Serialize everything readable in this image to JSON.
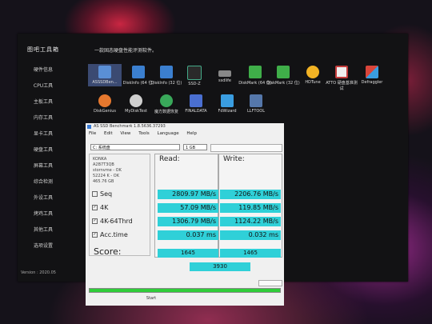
{
  "sidebar": {
    "title": "图吧工具箱",
    "items": [
      "硬件信息",
      "CPU工具",
      "主板工具",
      "内存工具",
      "显卡工具",
      "硬盘工具",
      "屏幕工具",
      "综合检测",
      "外设工具",
      "烤鸡工具",
      "其他工具",
      "选项设置"
    ],
    "version": "Version : 2020.05"
  },
  "main": {
    "description": "一款固态硬盘性能评测软件。",
    "apps_row1": [
      {
        "label": "ASSSDBen...",
        "icon": "as-ssd-icon",
        "color": "#5a8fd6",
        "selected": true
      },
      {
        "label": "DiskInfo (64 位)",
        "icon": "diskinfo-icon",
        "color": "#3b7fcf"
      },
      {
        "label": "DiskInfo (32 位)",
        "icon": "diskinfo-icon",
        "color": "#3b7fcf"
      },
      {
        "label": "SSD-Z",
        "icon": "ssdz-icon",
        "color": "#2a2a2a"
      },
      {
        "label": "ssdlife",
        "icon": "ssdlife-icon",
        "color": "#888888"
      },
      {
        "label": "DiskMark (64 位)",
        "icon": "diskmark-icon",
        "color": "#3fae49"
      },
      {
        "label": "DiskMark (32 位)",
        "icon": "diskmark-icon",
        "color": "#3fae49"
      },
      {
        "label": "HDTune",
        "icon": "hdtune-icon",
        "color": "#f2b324"
      },
      {
        "label": "ATTO 硬盘基准测试",
        "icon": "atto-icon",
        "color": "#c23b3b"
      },
      {
        "label": "Defraggler",
        "icon": "defraggler-icon",
        "color": "#d9453b"
      }
    ],
    "apps_row2": [
      {
        "label": "DiskGenius",
        "icon": "diskgenius-icon",
        "color": "#e6782e"
      },
      {
        "label": "MyDiskTest",
        "icon": "mydisktest-icon",
        "color": "#cfcfcf"
      },
      {
        "label": "魔方数据恢复",
        "icon": "recovery-icon",
        "color": "#39a85a"
      },
      {
        "label": "FINALDATA",
        "icon": "finaldata-icon",
        "color": "#4a6fd1"
      },
      {
        "label": "FdWizard",
        "icon": "fdwizard-icon",
        "color": "#3a9de0"
      },
      {
        "label": "LLFTOOL",
        "icon": "llftool-icon",
        "color": "#5577aa"
      }
    ]
  },
  "asssd": {
    "title": "AS SSD Benchmark 1.8.5636.37293",
    "menu": [
      "File",
      "Edit",
      "View",
      "Tools",
      "Language",
      "Help"
    ],
    "drive": "C: 系统盘",
    "size": "1 GB",
    "info_lines": [
      "KONKA",
      "A2B7T3QB",
      "stornvme - OK",
      "52224 K - OK",
      "465.76 GB"
    ],
    "read_header": "Read:",
    "write_header": "Write:",
    "rows": [
      {
        "label": "Seq",
        "checked": "false",
        "read": "2809.97 MB/s",
        "write": "2206.76 MB/s"
      },
      {
        "label": "4K",
        "checked": "true",
        "read": "57.09 MB/s",
        "write": "119.85 MB/s"
      },
      {
        "label": "4K-64Thrd",
        "checked": "true",
        "read": "1306.79 MB/s",
        "write": "1124.22 MB/s"
      },
      {
        "label": "Acc.time",
        "checked": "true",
        "read": "0.037 ms",
        "write": "0.032 ms"
      }
    ],
    "score_label": "Score:",
    "score_read": "1645",
    "score_write": "1465",
    "score_total": "3930",
    "start_label": "Start",
    "progress": 1.0,
    "accent": "#2fd0d8"
  }
}
